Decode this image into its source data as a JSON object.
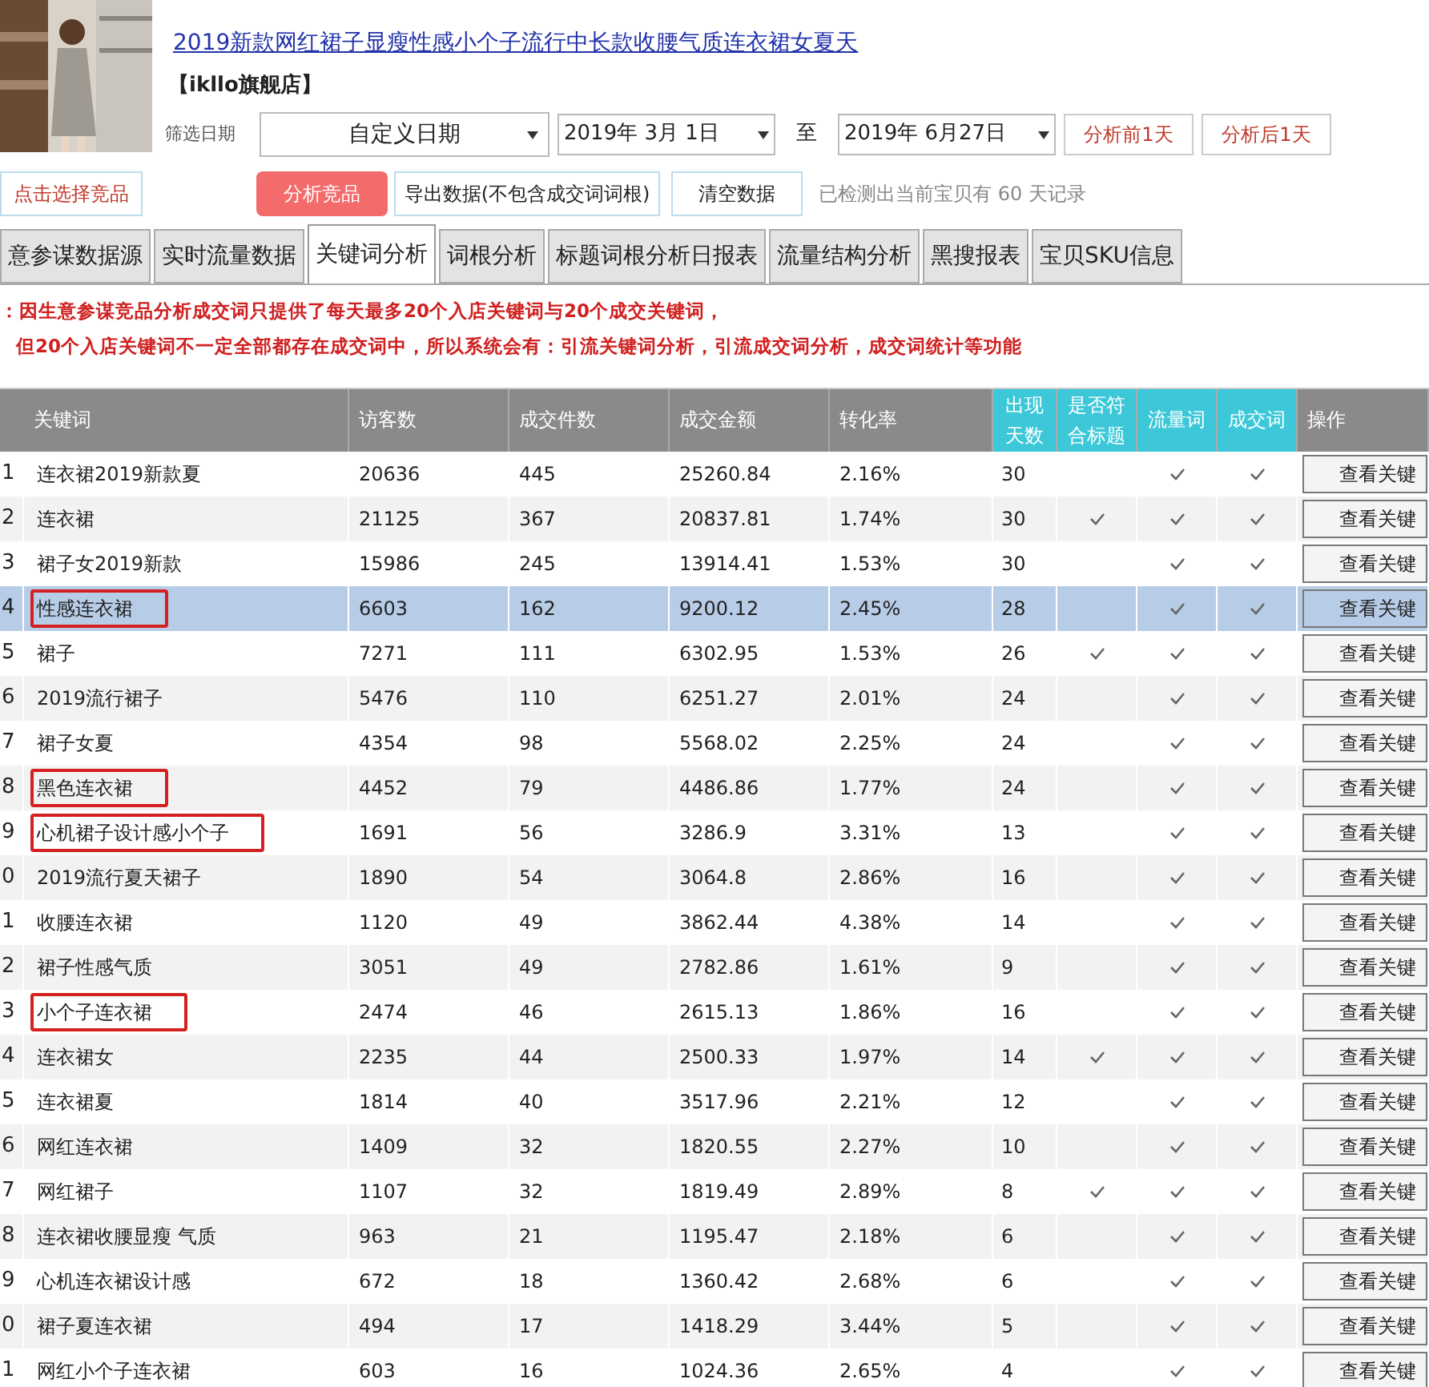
{
  "product": {
    "kind": "picture",
    "title": "2019新款网红裙子显瘦性感小个子流行中长款收腰气质连衣裙女夏天",
    "shop": "【ikllo旗舰店】"
  },
  "filter": {
    "label": "筛选日期",
    "mode": "自定义日期",
    "start": "2019年  3月  1日",
    "to": "至",
    "end": "2019年  6月27日",
    "prev_button": "分析前1天",
    "next_button": "分析后1天"
  },
  "actions": {
    "pick": "点击选择竞品",
    "analyze": "分析竞品",
    "export": "导出数据(不包含成交词词根)",
    "clear": "清空数据",
    "status": "已检测出当前宝贝有 60 天记录"
  },
  "tabs": [
    {
      "label": "意参谋数据源",
      "selected": false
    },
    {
      "label": "实时流量数据",
      "selected": false
    },
    {
      "label": "关键词分析",
      "selected": true
    },
    {
      "label": "词根分析",
      "selected": false
    },
    {
      "label": "标题词根分析日报表",
      "selected": false
    },
    {
      "label": "流量结构分析",
      "selected": false
    },
    {
      "label": "黑搜报表",
      "selected": false
    },
    {
      "label": "宝贝SKU信息",
      "selected": false
    }
  ],
  "notice": [
    "：因生意参谋竞品分析成交词只提供了每天最多20个入店关键词与20个成交关键词，",
    "但20个入店关键词不一定全部都存在成交词中，所以系统会有：引流关键词分析，引流成交词分析，成交词统计等功能"
  ],
  "table": {
    "columns": [
      "关键词",
      "访客数",
      "成交件数",
      "成交金额",
      "转化率",
      "出现天数",
      "是否符合标题",
      "流量词",
      "成交词",
      "操作"
    ],
    "rows": [
      {
        "index": "1",
        "keyword": "连衣裙2019新款夏",
        "visitors": "20636",
        "orders": "445",
        "amount": "25260.84",
        "rate": "2.16%",
        "days": "30",
        "in_title": false,
        "traffic": true,
        "deal": true,
        "action": "查看关键",
        "selected": false,
        "marked": false
      },
      {
        "index": "2",
        "keyword": "连衣裙",
        "visitors": "21125",
        "orders": "367",
        "amount": "20837.81",
        "rate": "1.74%",
        "days": "30",
        "in_title": true,
        "traffic": true,
        "deal": true,
        "action": "查看关键",
        "selected": false,
        "marked": false
      },
      {
        "index": "3",
        "keyword": "裙子女2019新款",
        "visitors": "15986",
        "orders": "245",
        "amount": "13914.41",
        "rate": "1.53%",
        "days": "30",
        "in_title": false,
        "traffic": true,
        "deal": true,
        "action": "查看关键",
        "selected": false,
        "marked": false
      },
      {
        "index": "4",
        "keyword": "性感连衣裙",
        "visitors": "6603",
        "orders": "162",
        "amount": "9200.12",
        "rate": "2.45%",
        "days": "28",
        "in_title": false,
        "traffic": true,
        "deal": true,
        "action": "查看关键",
        "selected": true,
        "marked": true
      },
      {
        "index": "5",
        "keyword": "裙子",
        "visitors": "7271",
        "orders": "111",
        "amount": "6302.95",
        "rate": "1.53%",
        "days": "26",
        "in_title": true,
        "traffic": true,
        "deal": true,
        "action": "查看关键",
        "selected": false,
        "marked": false
      },
      {
        "index": "6",
        "keyword": "2019流行裙子",
        "visitors": "5476",
        "orders": "110",
        "amount": "6251.27",
        "rate": "2.01%",
        "days": "24",
        "in_title": false,
        "traffic": true,
        "deal": true,
        "action": "查看关键",
        "selected": false,
        "marked": false
      },
      {
        "index": "7",
        "keyword": "裙子女夏",
        "visitors": "4354",
        "orders": "98",
        "amount": "5568.02",
        "rate": "2.25%",
        "days": "24",
        "in_title": false,
        "traffic": true,
        "deal": true,
        "action": "查看关键",
        "selected": false,
        "marked": false
      },
      {
        "index": "8",
        "keyword": "黑色连衣裙",
        "visitors": "4452",
        "orders": "79",
        "amount": "4486.86",
        "rate": "1.77%",
        "days": "24",
        "in_title": false,
        "traffic": true,
        "deal": true,
        "action": "查看关键",
        "selected": false,
        "marked": true
      },
      {
        "index": "9",
        "keyword": "心机裙子设计感小个子",
        "visitors": "1691",
        "orders": "56",
        "amount": "3286.9",
        "rate": "3.31%",
        "days": "13",
        "in_title": false,
        "traffic": true,
        "deal": true,
        "action": "查看关键",
        "selected": false,
        "marked": true
      },
      {
        "index": "0",
        "keyword": "2019流行夏天裙子",
        "visitors": "1890",
        "orders": "54",
        "amount": "3064.8",
        "rate": "2.86%",
        "days": "16",
        "in_title": false,
        "traffic": true,
        "deal": true,
        "action": "查看关键",
        "selected": false,
        "marked": false
      },
      {
        "index": "1",
        "keyword": "收腰连衣裙",
        "visitors": "1120",
        "orders": "49",
        "amount": "3862.44",
        "rate": "4.38%",
        "days": "14",
        "in_title": false,
        "traffic": true,
        "deal": true,
        "action": "查看关键",
        "selected": false,
        "marked": false
      },
      {
        "index": "2",
        "keyword": "裙子性感气质",
        "visitors": "3051",
        "orders": "49",
        "amount": "2782.86",
        "rate": "1.61%",
        "days": "9",
        "in_title": false,
        "traffic": true,
        "deal": true,
        "action": "查看关键",
        "selected": false,
        "marked": false
      },
      {
        "index": "3",
        "keyword": "小个子连衣裙",
        "visitors": "2474",
        "orders": "46",
        "amount": "2615.13",
        "rate": "1.86%",
        "days": "16",
        "in_title": false,
        "traffic": true,
        "deal": true,
        "action": "查看关键",
        "selected": false,
        "marked": true
      },
      {
        "index": "4",
        "keyword": "连衣裙女",
        "visitors": "2235",
        "orders": "44",
        "amount": "2500.33",
        "rate": "1.97%",
        "days": "14",
        "in_title": true,
        "traffic": true,
        "deal": true,
        "action": "查看关键",
        "selected": false,
        "marked": false
      },
      {
        "index": "5",
        "keyword": "连衣裙夏",
        "visitors": "1814",
        "orders": "40",
        "amount": "3517.96",
        "rate": "2.21%",
        "days": "12",
        "in_title": false,
        "traffic": true,
        "deal": true,
        "action": "查看关键",
        "selected": false,
        "marked": false
      },
      {
        "index": "6",
        "keyword": "网红连衣裙",
        "visitors": "1409",
        "orders": "32",
        "amount": "1820.55",
        "rate": "2.27%",
        "days": "10",
        "in_title": false,
        "traffic": true,
        "deal": true,
        "action": "查看关键",
        "selected": false,
        "marked": false
      },
      {
        "index": "7",
        "keyword": "网红裙子",
        "visitors": "1107",
        "orders": "32",
        "amount": "1819.49",
        "rate": "2.89%",
        "days": "8",
        "in_title": true,
        "traffic": true,
        "deal": true,
        "action": "查看关键",
        "selected": false,
        "marked": false
      },
      {
        "index": "8",
        "keyword": "连衣裙收腰显瘦 气质",
        "visitors": "963",
        "orders": "21",
        "amount": "1195.47",
        "rate": "2.18%",
        "days": "6",
        "in_title": false,
        "traffic": true,
        "deal": true,
        "action": "查看关键",
        "selected": false,
        "marked": false
      },
      {
        "index": "9",
        "keyword": "心机连衣裙设计感",
        "visitors": "672",
        "orders": "18",
        "amount": "1360.42",
        "rate": "2.68%",
        "days": "6",
        "in_title": false,
        "traffic": true,
        "deal": true,
        "action": "查看关键",
        "selected": false,
        "marked": false
      },
      {
        "index": "0",
        "keyword": "裙子夏连衣裙",
        "visitors": "494",
        "orders": "17",
        "amount": "1418.29",
        "rate": "3.44%",
        "days": "5",
        "in_title": false,
        "traffic": true,
        "deal": true,
        "action": "查看关键",
        "selected": false,
        "marked": false
      },
      {
        "index": "1",
        "keyword": "网红小个子连衣裙",
        "visitors": "603",
        "orders": "16",
        "amount": "1024.36",
        "rate": "2.65%",
        "days": "4",
        "in_title": false,
        "traffic": true,
        "deal": true,
        "action": "查看关键",
        "selected": false,
        "marked": false
      }
    ]
  }
}
